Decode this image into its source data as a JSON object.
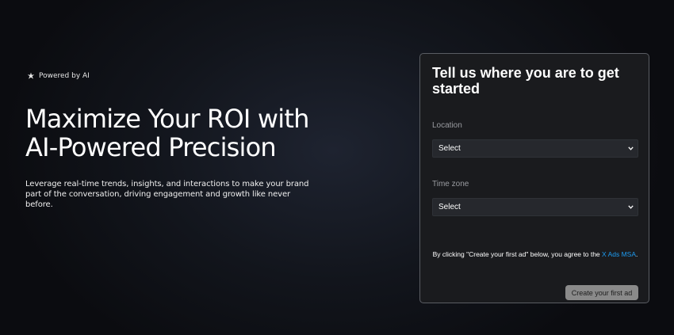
{
  "hero": {
    "badge_label": "Powered by AI",
    "badge_icon": "sparkle-icon",
    "headline": "Maximize Your ROI with AI-Powered Precision",
    "subtext": "Leverage real-time trends, insights, and interactions to make your brand part of the conversation, driving engagement and growth like never before."
  },
  "form": {
    "title": "Tell us where you are to get started",
    "location": {
      "label": "Location",
      "value": "Select"
    },
    "timezone": {
      "label": "Time zone",
      "value": "Select"
    },
    "agreement": {
      "prefix": "By clicking \"Create your first ad\" below, you agree to the ",
      "link_text": "X Ads MSA",
      "suffix": "."
    },
    "submit_label": "Create your first ad"
  },
  "colors": {
    "link": "#1d9bf0",
    "card_background": "#1a1b1e",
    "button_background": "#8a8a8a"
  }
}
